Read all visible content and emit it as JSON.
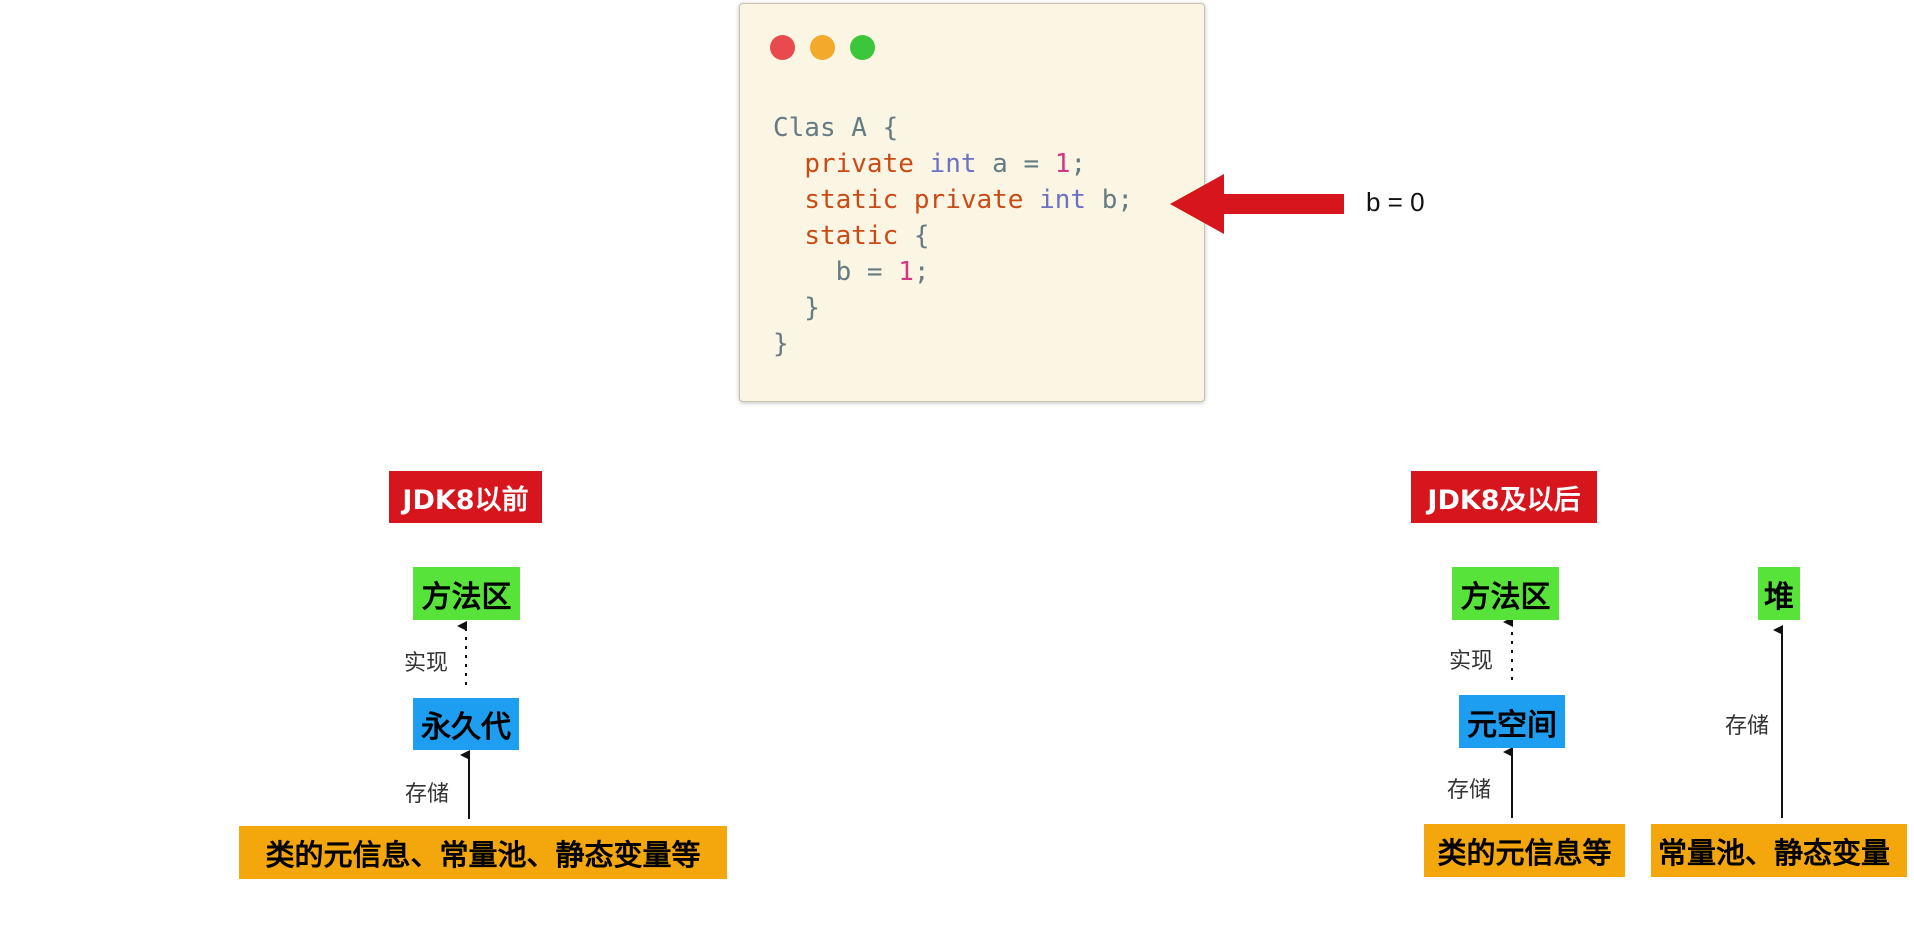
{
  "code_window": {
    "window_buttons": {
      "close_color": "#e94a4d",
      "minimize_color": "#f3aa2b",
      "maximize_color": "#3bc63c"
    },
    "lines": [
      [
        {
          "t": "Clas A {",
          "c": "plain"
        }
      ],
      [
        {
          "t": "  ",
          "c": "plain"
        },
        {
          "t": "private",
          "c": "kw"
        },
        {
          "t": " ",
          "c": "plain"
        },
        {
          "t": "int",
          "c": "ty"
        },
        {
          "t": " a = ",
          "c": "plain"
        },
        {
          "t": "1",
          "c": "num"
        },
        {
          "t": ";",
          "c": "plain"
        }
      ],
      [
        {
          "t": "  ",
          "c": "plain"
        },
        {
          "t": "static private",
          "c": "kw"
        },
        {
          "t": " ",
          "c": "plain"
        },
        {
          "t": "int",
          "c": "ty"
        },
        {
          "t": " b;",
          "c": "plain"
        }
      ],
      [
        {
          "t": "  ",
          "c": "plain"
        },
        {
          "t": "static",
          "c": "kw"
        },
        {
          "t": " {",
          "c": "plain"
        }
      ],
      [
        {
          "t": "    b = ",
          "c": "plain"
        },
        {
          "t": "1",
          "c": "num"
        },
        {
          "t": ";",
          "c": "plain"
        }
      ],
      [
        {
          "t": "  }",
          "c": "plain"
        }
      ],
      [
        {
          "t": "}",
          "c": "plain"
        }
      ]
    ]
  },
  "annotation": {
    "text": "b = 0",
    "arrow_color": "#d7151c"
  },
  "colors": {
    "tag_red": "#d7151c",
    "box_green": "#58e33b",
    "box_blue": "#1e9ef0",
    "box_orange": "#f4a70d"
  },
  "before_jdk8": {
    "tag": "JDK8以前",
    "method_area": "方法区",
    "implements_label": "实现",
    "implementation": "永久代",
    "stores_label": "存储",
    "contents": "类的元信息、常量池、静态变量等"
  },
  "jdk8_and_after": {
    "tag": "JDK8及以后",
    "method_area": "方法区",
    "implements_label": "实现",
    "implementation": "元空间",
    "stores_label_left": "存储",
    "contents_left": "类的元信息等",
    "heap": "堆",
    "stores_label_right": "存储",
    "contents_right": "常量池、静态变量"
  }
}
